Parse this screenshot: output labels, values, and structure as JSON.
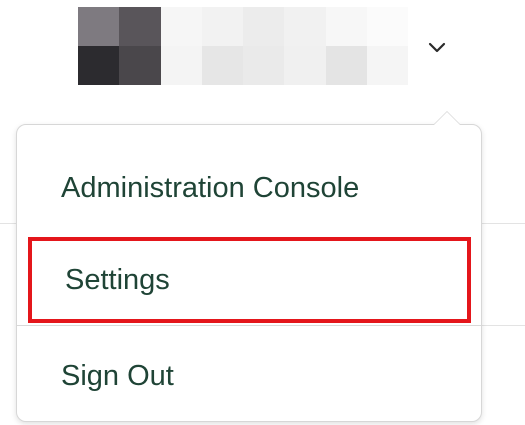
{
  "user_menu": {
    "toggle_icon": "chevron-down-icon",
    "avatar_pixels": [
      "#7e7a80",
      "#59555a",
      "#f6f6f6",
      "#f2f2f2",
      "#ececec",
      "#f1f1f1",
      "#f7f7f7",
      "#fbfbfb",
      "#2c2b2f",
      "#4a474b",
      "#f4f4f4",
      "#e6e6e6",
      "#eaeaea",
      "#f0f0f0",
      "#e4e4e4",
      "#f5f5f5"
    ]
  },
  "menu": {
    "items": [
      {
        "label": "Administration Console",
        "highlighted": false
      },
      {
        "label": "Settings",
        "highlighted": true
      },
      {
        "label": "Sign Out",
        "highlighted": false
      }
    ]
  },
  "colors": {
    "text": "#1f4436",
    "highlight": "#e4161b",
    "border": "#d7d7d7"
  }
}
